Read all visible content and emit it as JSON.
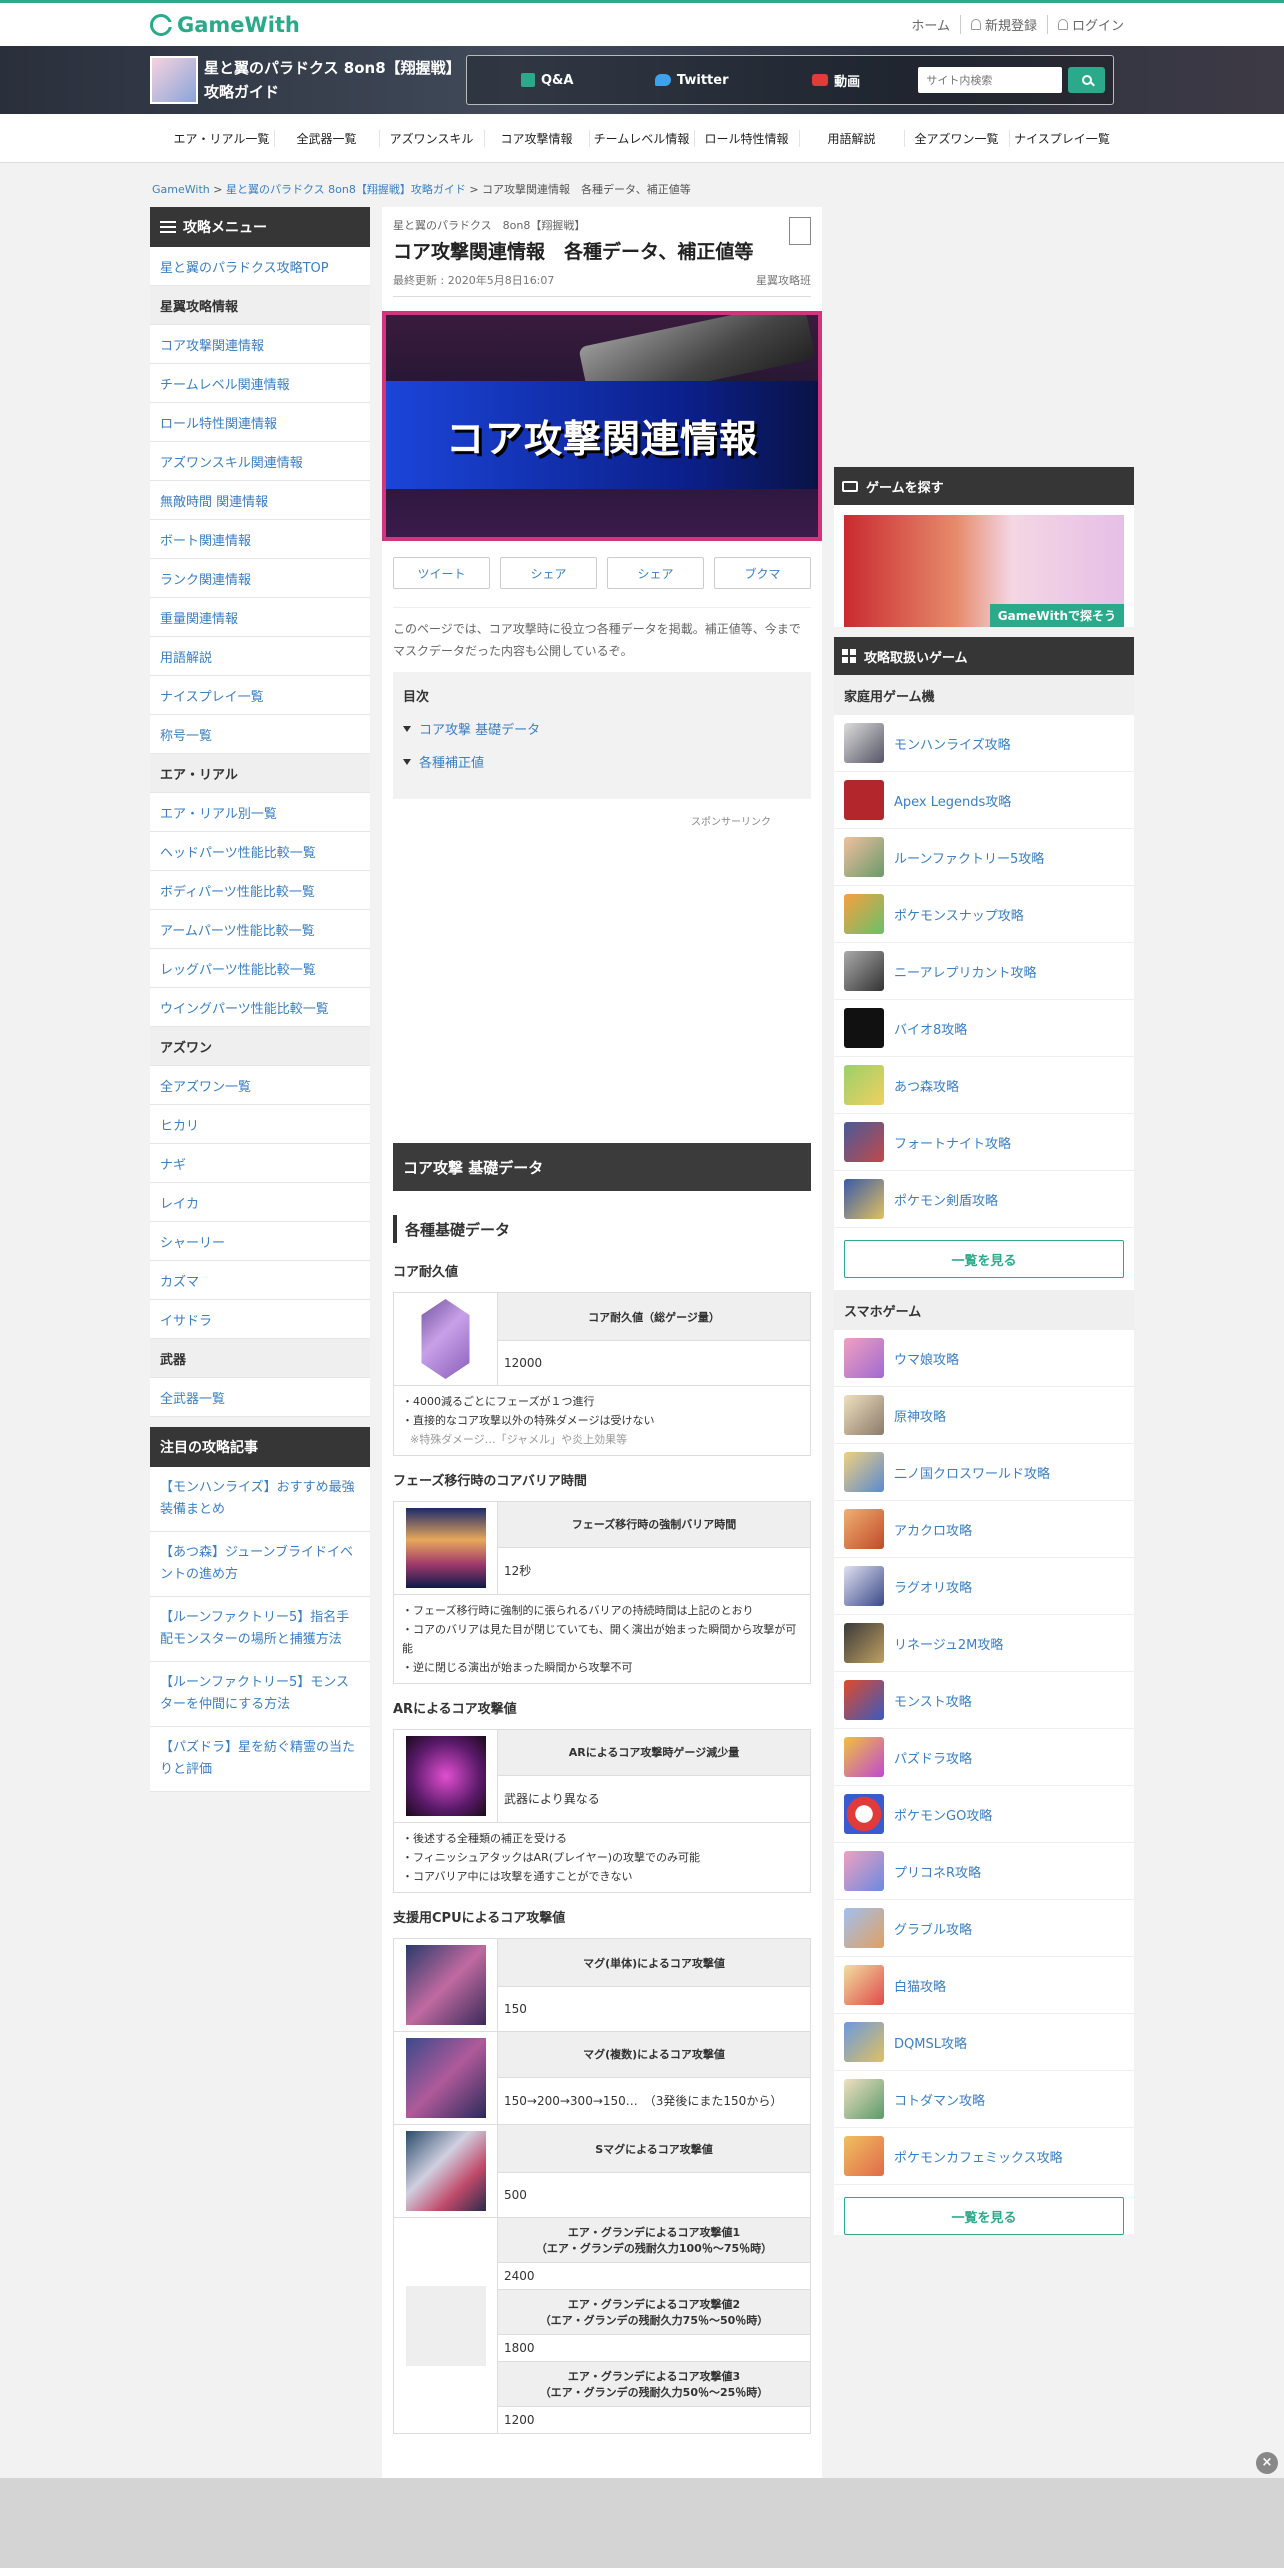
{
  "header": {
    "logo": "GameWith",
    "links": [
      "ホーム",
      "新規登録",
      "ログイン"
    ]
  },
  "banner": {
    "title": "星と翼のパラドクス 8on8【翔握戦】攻略ガイド",
    "nav": [
      "Q&A",
      "Twitter",
      "動画"
    ],
    "search_placeholder": "サイト内検索"
  },
  "catnav": [
    "エア・リアル一覧",
    "全武器一覧",
    "アズワンスキル",
    "コア攻撃情報",
    "チームレベル情報",
    "ロール特性情報",
    "用語解説",
    "全アズワン一覧",
    "ナイスプレイ一覧"
  ],
  "breadcrumb": [
    "GameWith",
    "星と翼のパラドクス 8on8【翔握戦】攻略ガイド",
    "コア攻撃関連情報　各種データ、補正値等"
  ],
  "left": {
    "menu_title": "攻略メニュー",
    "top_link": "星と翼のパラドクス攻略TOP",
    "sections": [
      {
        "title": "星翼攻略情報",
        "items": [
          "コア攻撃関連情報",
          "チームレベル関連情報",
          "ロール特性関連情報",
          "アズワンスキル関連情報",
          "無敵時間 関連情報",
          "ボート関連情報",
          "ランク関連情報",
          "重量関連情報",
          "用語解説",
          "ナイスプレイ一覧",
          "称号一覧"
        ]
      },
      {
        "title": "エア・リアル",
        "items": [
          "エア・リアル別一覧",
          "ヘッドパーツ性能比較一覧",
          "ボディパーツ性能比較一覧",
          "アームパーツ性能比較一覧",
          "レッグパーツ性能比較一覧",
          "ウイングパーツ性能比較一覧"
        ]
      },
      {
        "title": "アズワン",
        "items": [
          "全アズワン一覧",
          "ヒカリ",
          "ナギ",
          "レイカ",
          "シャーリー",
          "カズマ",
          "イサドラ"
        ]
      },
      {
        "title": "武器",
        "items": [
          "全武器一覧"
        ]
      }
    ],
    "notice_title": "注目の攻略記事",
    "notices": [
      "【モンハンライズ】おすすめ最強装備まとめ",
      "【あつ森】ジューンブライドイベントの進め方",
      "【ルーンファクトリー5】指名手配モンスターの場所と捕獲方法",
      "【ルーンファクトリー5】モンスターを仲間にする方法",
      "【パズドラ】星を紡ぐ精霊の当たりと評価"
    ]
  },
  "article": {
    "category": "星と翼のパラドクス　8on8【翔握戦】",
    "title": "コア攻撃関連情報　各種データ、補正値等",
    "updated": "最終更新 : 2020年5月8日16:07",
    "author": "星翼攻略班",
    "hero_text": "コア攻撃関連情報",
    "share": [
      "ツイート",
      "シェア",
      "シェア",
      "ブクマ"
    ],
    "intro": "このページでは、コア攻撃時に役立つ各種データを掲載。補正値等、今までマスクデータだった内容も公開しているぞ。",
    "toc_title": "目次",
    "toc": [
      "コア攻撃 基礎データ",
      "各種補正値"
    ],
    "sponsor": "スポンサーリンク",
    "h2": "コア攻撃 基礎データ",
    "h3": "各種基礎データ",
    "blocks": [
      {
        "heading": "コア耐久値",
        "th": "コア耐久値（総ゲージ量）",
        "td": "12000",
        "notes": [
          "・4000減るごとにフェーズが１つ進行",
          "・直接的なコア攻撃以外の特殊ダメージは受けない"
        ],
        "subnote": "※特殊ダメージ…「ジャメル」や炎上効果等"
      },
      {
        "heading": "フェーズ移行時のコアバリア時間",
        "th": "フェーズ移行時の強制バリア時間",
        "td": "12秒",
        "notes": [
          "・フェーズ移行時に強制的に張られるバリアの持続時間は上記のとおり",
          "・コアのバリアは見た目が閉じていても、開く演出が始まった瞬間から攻撃が可能",
          "・逆に閉じる演出が始まった瞬間から攻撃不可"
        ]
      },
      {
        "heading": "ARによるコア攻撃値",
        "th": "ARによるコア攻撃時ゲージ減少量",
        "td": "武器により異なる",
        "notes": [
          "・後述する全種類の補正を受ける",
          "・フィニッシュアタックはAR(プレイヤー)の攻撃でのみ可能",
          "・コアバリア中には攻撃を通すことができない"
        ]
      }
    ],
    "cpu_heading": "支援用CPUによるコア攻撃値",
    "cpu_rows": [
      {
        "th": "マグ(単体)によるコア攻撃値",
        "td": "150"
      },
      {
        "th": "マグ(複数)によるコア攻撃値",
        "td": "150→200→300→150…　（3発後にまた150から）"
      },
      {
        "th": "Sマグによるコア攻撃値",
        "td": "500"
      }
    ],
    "grande_rows": [
      {
        "th1": "エア・グランデによるコア攻撃値1",
        "th2": "（エア・グランデの残耐久力100％～75％時）",
        "td": "2400"
      },
      {
        "th1": "エア・グランデによるコア攻撃値2",
        "th2": "（エア・グランデの残耐久力75％～50％時）",
        "td": "1800"
      },
      {
        "th1": "エア・グランデによるコア攻撃値3",
        "th2": "（エア・グランデの残耐久力50％～25％時）",
        "td": "1200"
      }
    ]
  },
  "right": {
    "find_title": "ゲームを探す",
    "ad_badge": "GameWithで探そう",
    "list_title": "攻略取扱いゲーム",
    "home_title": "家庭用ゲーム機",
    "home_games": [
      "モンハンライズ攻略",
      "Apex Legends攻略",
      "ルーンファクトリー5攻略",
      "ポケモンスナップ攻略",
      "ニーアレプリカント攻略",
      "バイオ8攻略",
      "あつ森攻略",
      "フォートナイト攻略",
      "ポケモン剣盾攻略"
    ],
    "more": "一覧を見る",
    "phone_title": "スマホゲーム",
    "phone_games": [
      "ウマ娘攻略",
      "原神攻略",
      "二ノ国クロスワールド攻略",
      "アカクロ攻略",
      "ラグオリ攻略",
      "リネージュ2M攻略",
      "モンスト攻略",
      "パズドラ攻略",
      "ポケモンGO攻略",
      "プリコネR攻略",
      "グラブル攻略",
      "白猫攻略",
      "DQMSL攻略",
      "コトダマン攻略",
      "ポケモンカフェミックス攻略"
    ]
  },
  "colors": {
    "brand": "#2aaa8a",
    "link": "#3b7fc4",
    "dark": "#363636"
  }
}
